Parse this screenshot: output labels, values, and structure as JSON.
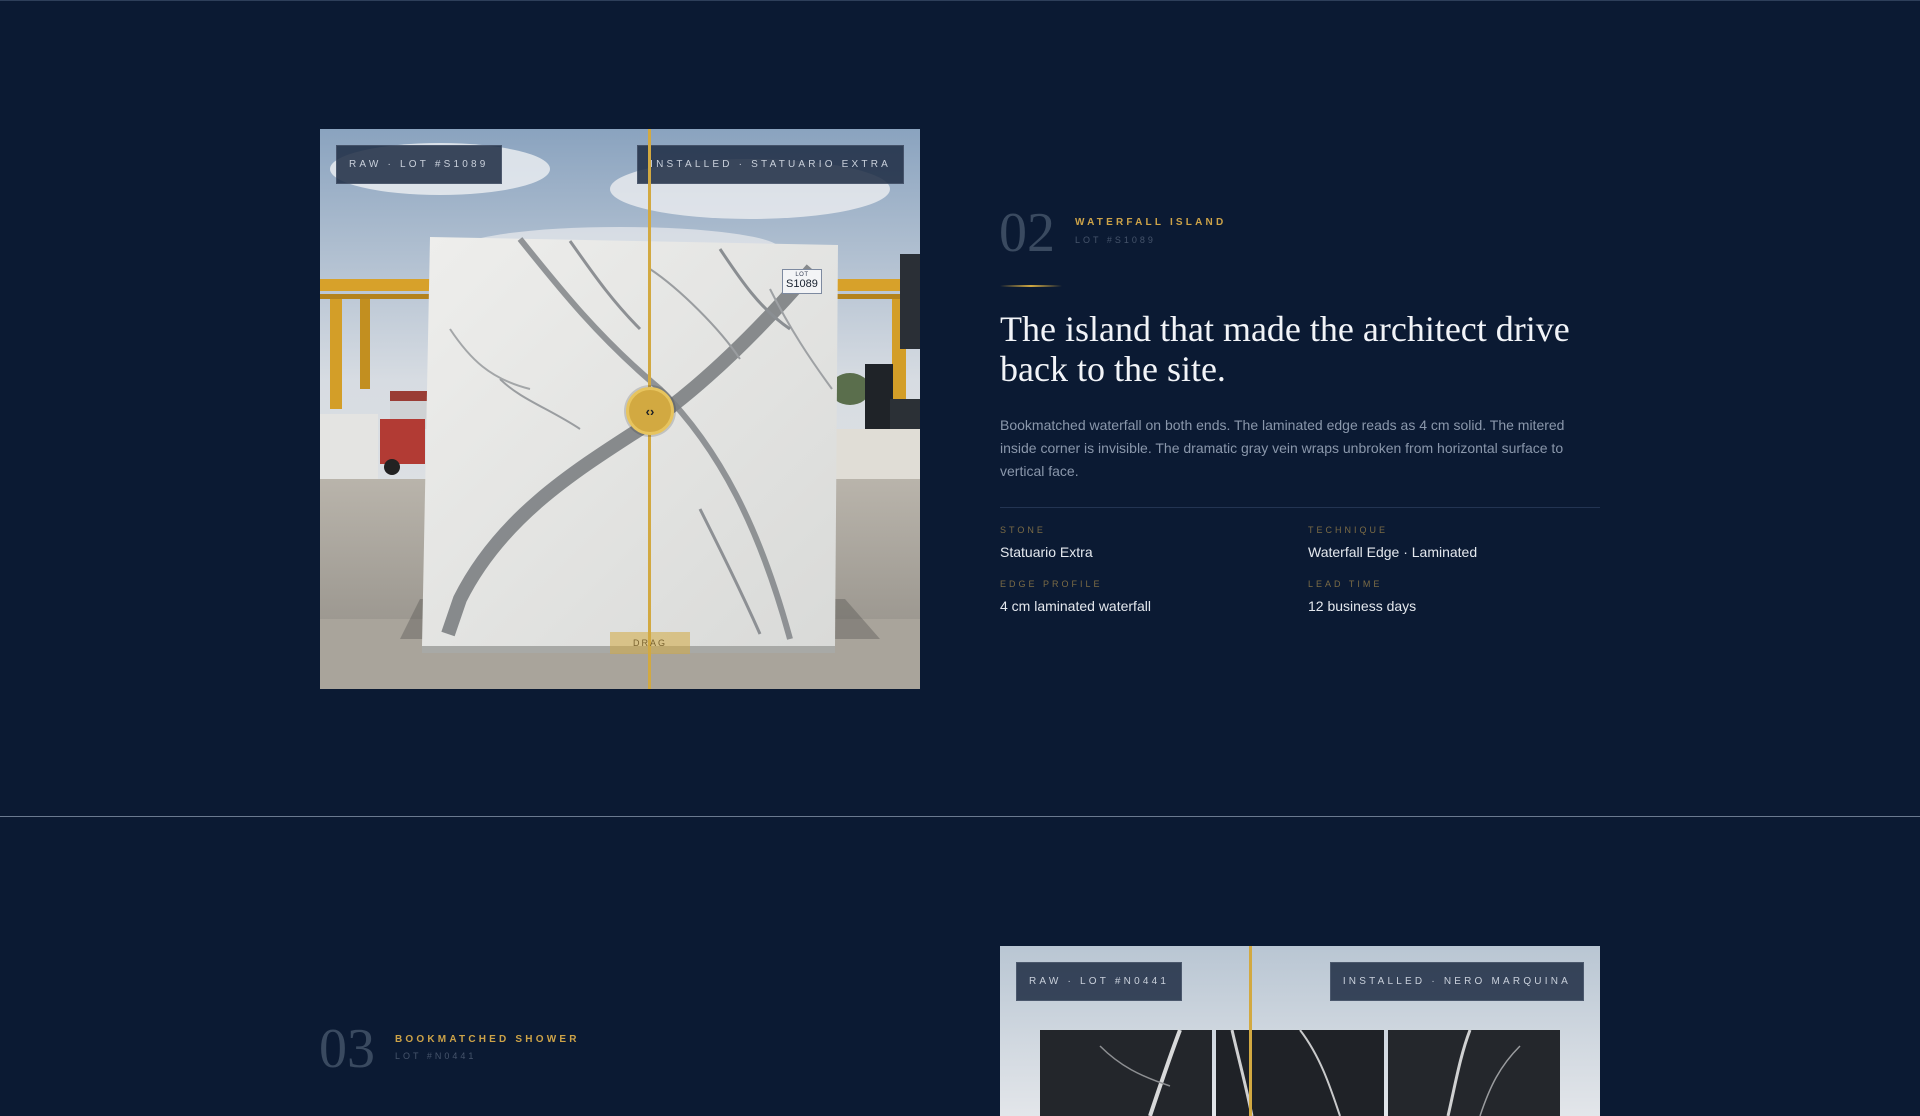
{
  "project_02": {
    "index": "02",
    "kicker": "WATERFALL ISLAND",
    "lot": "LOT #S1089",
    "headline": "The island that made the architect drive back to the site.",
    "description": "Bookmatched waterfall on both ends. The laminated edge reads as 4 cm solid. The mitered inside corner is invisible. The dramatic gray vein wraps unbroken from horizontal surface to vertical face.",
    "compare": {
      "raw_badge": "RAW · LOT #S1089",
      "installed_badge": "INSTALLED · STATUARIO EXTRA",
      "handle_glyph": "‹›",
      "drag_label": "DRAG",
      "slab_tag_line1": "LOT",
      "slab_tag_line2": "S1089"
    },
    "specs": [
      {
        "label": "STONE",
        "value": "Statuario Extra"
      },
      {
        "label": "TECHNIQUE",
        "value": "Waterfall Edge · Laminated"
      },
      {
        "label": "EDGE PROFILE",
        "value": "4 cm laminated waterfall"
      },
      {
        "label": "LEAD TIME",
        "value": "12 business days"
      }
    ]
  },
  "project_03": {
    "index": "03",
    "kicker": "BOOKMATCHED SHOWER",
    "lot": "LOT #N0441",
    "compare": {
      "raw_badge": "RAW · LOT #N0441",
      "installed_badge": "INSTALLED · NERO MARQUINA"
    }
  },
  "colors": {
    "background": "#0b1a33",
    "accent_gold": "#d2a941",
    "text_muted": "#8a97ab"
  }
}
